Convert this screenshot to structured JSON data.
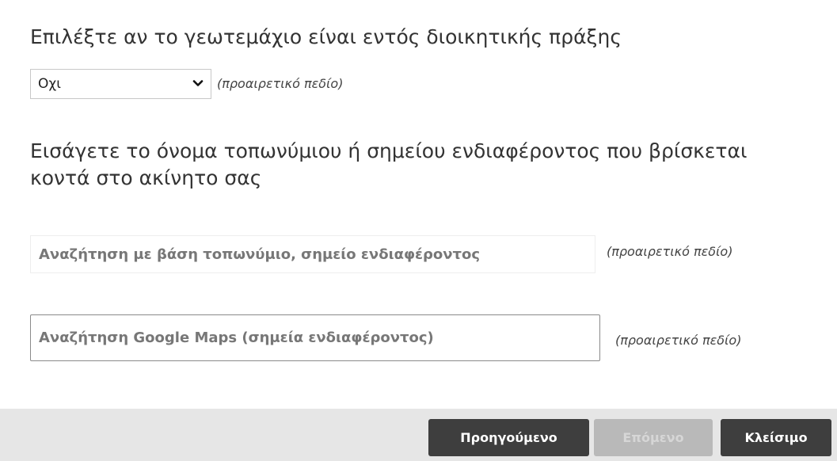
{
  "form": {
    "administrative_act": {
      "label": "Επιλέξτε αν το γεωτεμάχιο είναι εντός διοικητικής πράξης",
      "selected": "Οχι",
      "hint": "(προαιρετικό πεδίο)"
    },
    "place": {
      "label": "Εισάγετε το όνομα τοπωνύμιου ή σημείου ενδιαφέροντος που βρίσκεται κοντά στο ακίνητο σας",
      "search_placeholder": "Αναζήτηση με βάση τοπωνύμιο, σημείο ενδιαφέροντος",
      "search_hint": "(προαιρετικό πεδίο)",
      "google_placeholder": "Αναζήτηση Google Maps (σημεία ενδιαφέροντος)",
      "google_hint": "(προαιρετικό πεδίο)"
    }
  },
  "footer": {
    "prev_label": "Προηγούμενο",
    "next_label": "Επόμενο",
    "next_disabled": true,
    "close_label": "Κλείσιμο"
  },
  "icons": {
    "dropdown": "chevron-down-icon"
  },
  "colors": {
    "button_dark": "#3e3e3e",
    "button_disabled": "#b9b9b9",
    "footer_bg": "#e6e6e6"
  }
}
